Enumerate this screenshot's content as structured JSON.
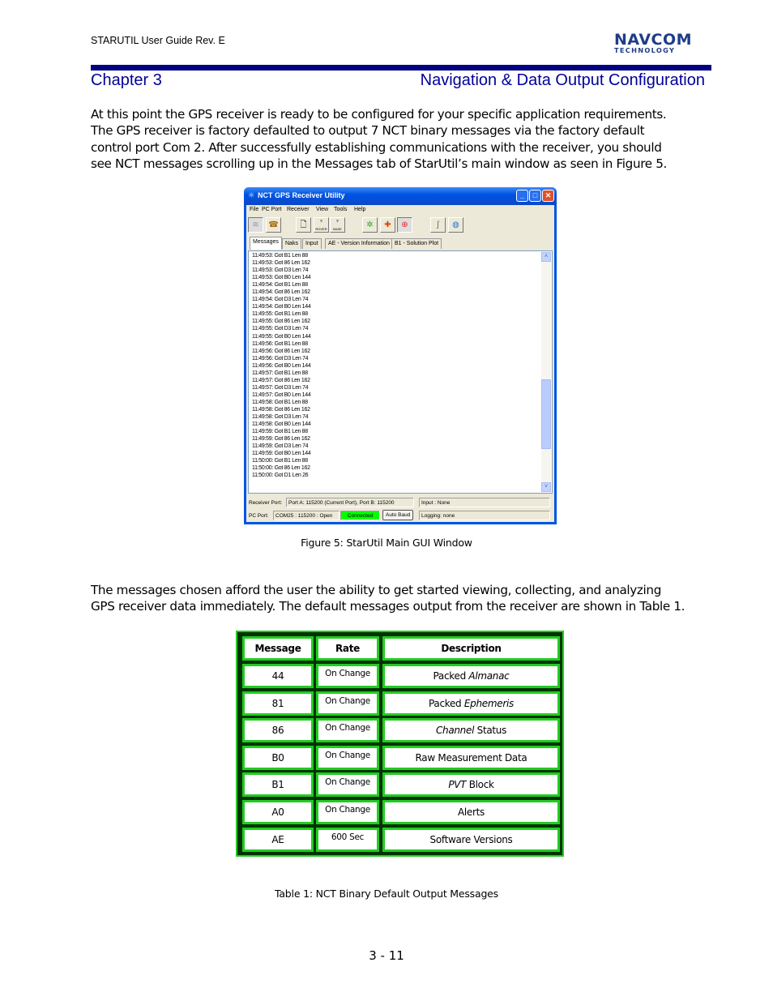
{
  "header": {
    "doc_title": "STARUTIL User Guide Rev. E",
    "logo_line1": "NAVCOM",
    "logo_line2": "TECHNOLOGY",
    "chapter": "Chapter 3",
    "chapter_title": "Navigation & Data Output Configuration",
    "rule_color": "#000080",
    "heading_color": "#000099"
  },
  "intro_paragraph": [
    "At this point the GPS receiver is ready to be configured for your specific application requirements.",
    "The GPS receiver is factory defaulted to output 7 NCT binary messages via the factory default",
    "control port Com 2. After successfully establishing communications with the receiver, you should",
    "see NCT messages scrolling up in the Messages tab of StarUtil’s main window as seen in Figure 5."
  ],
  "window": {
    "title": "NCT GPS Receiver Utility",
    "menu": [
      "File",
      "PC Port",
      "Receiver",
      "View",
      "Tools",
      "Help"
    ],
    "toolbar": [
      {
        "icon": "disconnect-icon",
        "glyph": "≋",
        "pressed": true
      },
      {
        "icon": "phone-connect-icon",
        "glyph": "☎",
        "pressed": false
      },
      {
        "icon": "new-document-icon",
        "glyph": "🗋",
        "pressed": false
      },
      {
        "icon": "rover-icon",
        "glyph": "♆",
        "label": "ROVER",
        "pressed": false
      },
      {
        "icon": "base-icon",
        "glyph": "♆",
        "label": "BASE",
        "pressed": false
      },
      {
        "icon": "satellite-icon",
        "glyph": "✲",
        "pressed": false
      },
      {
        "icon": "position-arrows-icon",
        "glyph": "✚",
        "pressed": false
      },
      {
        "icon": "target-icon",
        "glyph": "⊕",
        "pressed": true
      },
      {
        "icon": "cable-icon",
        "glyph": "∫",
        "pressed": false
      },
      {
        "icon": "globe-search-icon",
        "glyph": "◍",
        "pressed": false
      }
    ],
    "tabs": [
      {
        "label": "Messages",
        "active": true
      },
      {
        "label": "Naks",
        "active": false
      },
      {
        "label": "Input",
        "active": false
      },
      {
        "label": "AE - Version Information",
        "active": false
      },
      {
        "label": "B1 - Solution Plot",
        "active": false
      }
    ],
    "messages": [
      "11:49:53: Got B1 Len 88",
      "11:49:53: Got 86 Len 162",
      "11:49:53: Got D3 Len 74",
      "11:49:53: Got B0 Len 144",
      "11:49:54: Got B1 Len 88",
      "11:49:54: Got 86 Len 162",
      "11:49:54: Got D3 Len 74",
      "11:49:54: Got B0 Len 144",
      "11:49:55: Got B1 Len 88",
      "11:49:55: Got 86 Len 162",
      "11:49:55: Got D3 Len 74",
      "11:49:55: Got B0 Len 144",
      "11:49:56: Got B1 Len 88",
      "11:49:56: Got 86 Len 162",
      "11:49:56: Got D3 Len 74",
      "11:49:56: Got B0 Len 144",
      "11:49:57: Got B1 Len 88",
      "11:49:57: Got 86 Len 162",
      "11:49:57: Got D3 Len 74",
      "11:49:57: Got B0 Len 144",
      "11:49:58: Got B1 Len 88",
      "11:49:58: Got 86 Len 162",
      "11:49:58: Got D3 Len 74",
      "11:49:58: Got B0 Len 144",
      "11:49:59: Got B1 Len 88",
      "11:49:59: Got 86 Len 162",
      "11:49:59: Got D3 Len 74",
      "11:49:59: Got B0 Len 144",
      "11:50:00: Got B1 Len 88",
      "11:50:00: Got 86 Len 162",
      "11:50:00: Got D1 Len 26"
    ],
    "scroll_position": 0.78,
    "status": {
      "receiver_port_label": "Receiver Port:",
      "receiver_port_value": "Port A: 115200 (Current Port), Port B: 115200",
      "input_value": "Input : None",
      "pc_port_label": "PC Port:",
      "pc_port_value": "COM25 : 115200 : Open",
      "connection_status": "Connected",
      "connection_color": "#00ff00",
      "auto_baud_label": "Auto Baud",
      "logging_value": "Logging: none"
    }
  },
  "figure_caption": "Figure 5: StarUtil Main GUI Window",
  "second_paragraph": [
    "The messages chosen afford the user the ability to get started viewing, collecting, and analyzing",
    "GPS receiver data immediately. The default messages output from the receiver are shown in Table 1."
  ],
  "table": {
    "headers": [
      "Message",
      "Rate",
      "Description"
    ],
    "rows": [
      {
        "message": "44",
        "rate": "On Change",
        "desc_pre": "Packed ",
        "desc_italic": "Almanac",
        "desc_post": ""
      },
      {
        "message": "81",
        "rate": "On Change",
        "desc_pre": "Packed ",
        "desc_italic": "Ephemeris",
        "desc_post": ""
      },
      {
        "message": "86",
        "rate": "On Change",
        "desc_pre": "",
        "desc_italic": "Channel",
        "desc_post": " Status"
      },
      {
        "message": "B0",
        "rate": "On Change",
        "desc_pre": "Raw Measurement Data",
        "desc_italic": "",
        "desc_post": ""
      },
      {
        "message": "B1",
        "rate": "On Change",
        "desc_pre": "",
        "desc_italic": "PVT",
        "desc_post": " Block"
      },
      {
        "message": "A0",
        "rate": "On Change",
        "desc_pre": "Alerts",
        "desc_italic": "",
        "desc_post": ""
      },
      {
        "message": "AE",
        "rate": "600 Sec",
        "desc_pre": "Software Versions",
        "desc_italic": "",
        "desc_post": ""
      }
    ],
    "border_color": "#22cc22",
    "background_color": "#003300"
  },
  "table_caption": "Table 1: NCT Binary Default Output Messages",
  "page_number": "3 - 11"
}
